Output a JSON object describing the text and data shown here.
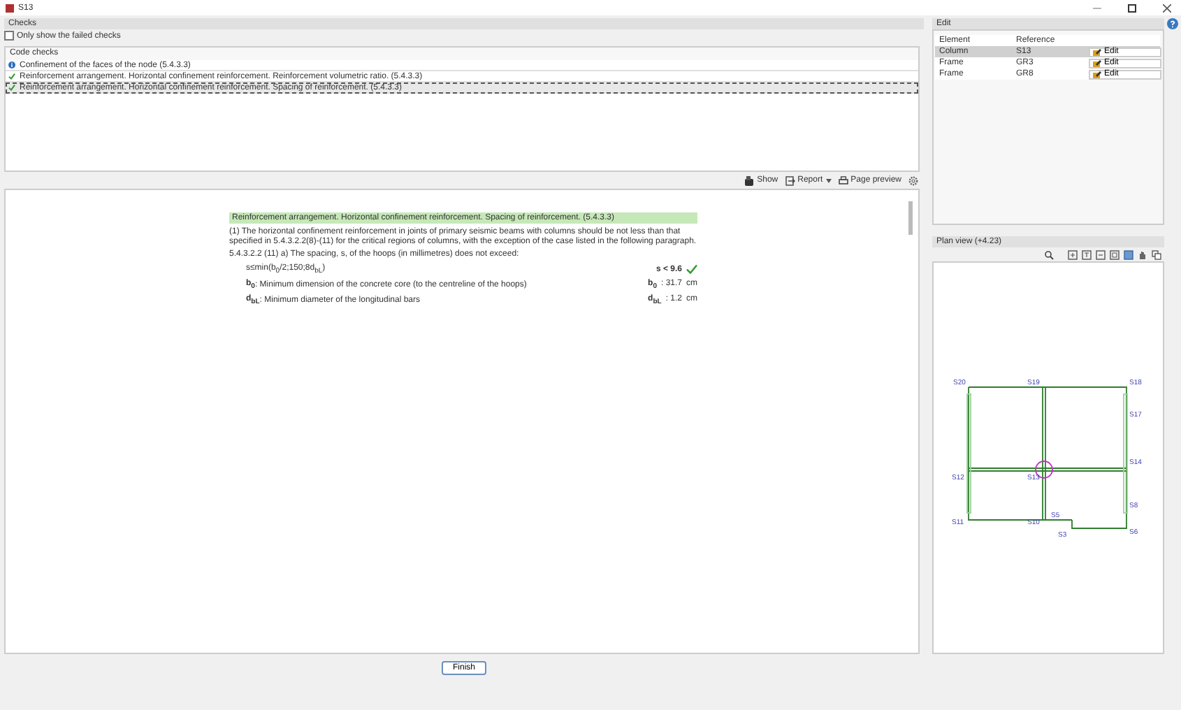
{
  "window": {
    "title": "S13"
  },
  "checks": {
    "title": "Checks",
    "only_failed": {
      "label": "Only show the failed checks",
      "checked": false
    },
    "code_checks": {
      "title": "Code checks",
      "items": [
        {
          "kind": "info",
          "text": "Confinement of the faces of the node (5.4.3.3)",
          "selected": false
        },
        {
          "kind": "pass",
          "text": "Reinforcement arrangement. Horizontal confinement reinforcement. Reinforcement volumetric ratio. (5.4.3.3)",
          "selected": false
        },
        {
          "kind": "pass",
          "text": "Reinforcement arrangement. Horizontal confinement reinforcement. Spacing of reinforcement. (5.4.3.3)",
          "selected": true
        }
      ]
    }
  },
  "toolbar": [
    {
      "kind": "show",
      "label": "Show"
    },
    {
      "kind": "report",
      "label": "Report",
      "dropdown": true
    },
    {
      "kind": "print",
      "label": "Page preview"
    },
    {
      "kind": "settings"
    }
  ],
  "report": {
    "heading": "Reinforcement arrangement. Horizontal confinement reinforcement. Spacing of reinforcement. (5.4.3.3)",
    "paragraph": "(1) The horizontal confinement reinforcement in joints of primary seismic beams with columns should be not less than that specified in 5.4.3.2.2(8)-(11) for the critical regions of columns, with the exception of the case listed in the following paragraph.",
    "clause": "5.4.3.2.2 (11) a) The spacing, s, of the hoops (in millimetres) does not exceed:",
    "formula": "s≤min(b$_{0}$/2;150;8d$_{bL}$)",
    "result": "s < 9.6",
    "passed": true,
    "variables": [
      {
        "symbol": "b$_{0}$",
        "description": ": Minimum dimension of the concrete core (to the centreline of the hoops)",
        "symbol_right": "b$_{0}$",
        "value": ": 31.7",
        "unit": "cm"
      },
      {
        "symbol": "d$_{bL}$",
        "description": ": Minimum diameter of the longitudinal bars",
        "symbol_right": "d$_{bL}$",
        "value": ": 1.2",
        "unit": "cm"
      }
    ]
  },
  "finish": "Finish",
  "edit": {
    "title": "Edit",
    "columns": [
      "Element",
      "Reference"
    ],
    "rows": [
      {
        "element": "Column",
        "reference": "S13",
        "action": "Edit",
        "selected": true
      },
      {
        "element": "Frame",
        "reference": "GR3",
        "action": "Edit",
        "selected": false
      },
      {
        "element": "Frame",
        "reference": "GR8",
        "action": "Edit",
        "selected": false
      }
    ]
  },
  "plan_view": {
    "title": "Plan view (+4.23)",
    "labels": [
      "S20",
      "S19",
      "S18",
      "S17",
      "S14",
      "S12",
      "S13",
      "S8",
      "S11",
      "S10",
      "S5",
      "S3",
      "S6"
    ]
  }
}
